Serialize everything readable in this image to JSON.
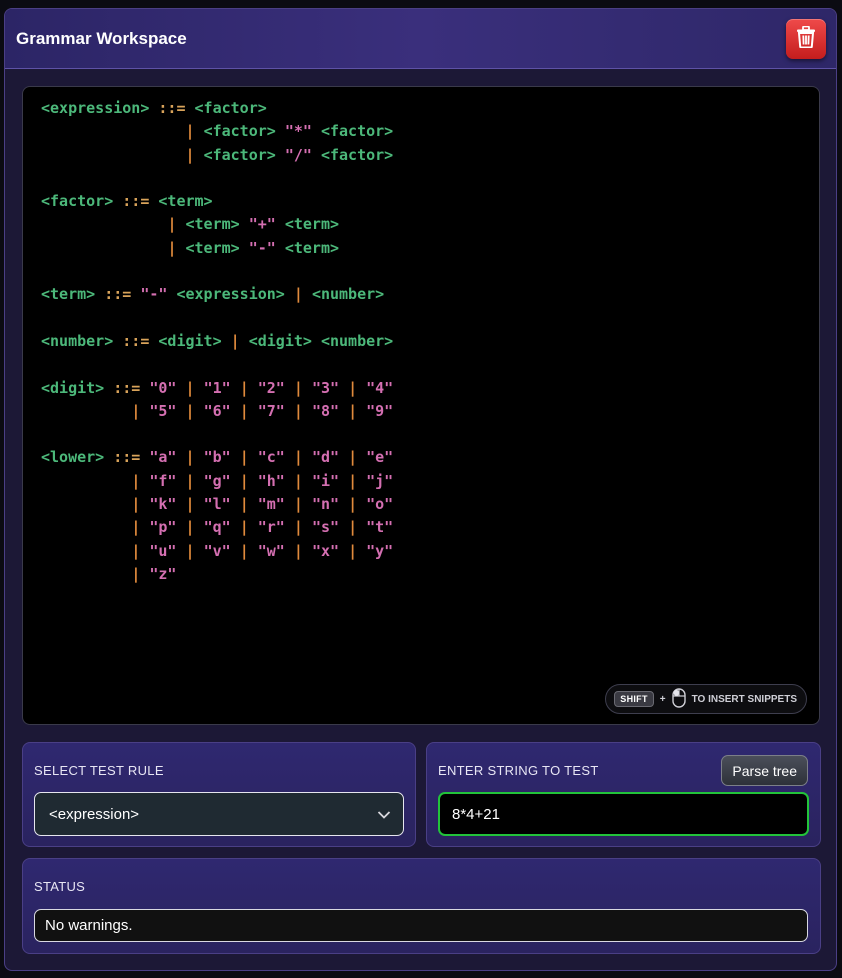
{
  "window": {
    "title": "Grammar Workspace"
  },
  "toolbar": {
    "delete_icon": "trash-icon",
    "delete_color": "#d92b2b"
  },
  "editor": {
    "lines": [
      [
        [
          "nt",
          "<expression>"
        ],
        [
          "sp",
          " "
        ],
        [
          "op",
          "::="
        ],
        [
          "sp",
          " "
        ],
        [
          "nt",
          "<factor>"
        ]
      ],
      [
        [
          "sp",
          "                "
        ],
        [
          "bar",
          "|"
        ],
        [
          "sp",
          " "
        ],
        [
          "nt",
          "<factor>"
        ],
        [
          "sp",
          " "
        ],
        [
          "lit",
          "\"*\""
        ],
        [
          "sp",
          " "
        ],
        [
          "nt",
          "<factor>"
        ]
      ],
      [
        [
          "sp",
          "                "
        ],
        [
          "bar",
          "|"
        ],
        [
          "sp",
          " "
        ],
        [
          "nt",
          "<factor>"
        ],
        [
          "sp",
          " "
        ],
        [
          "lit",
          "\"/\""
        ],
        [
          "sp",
          " "
        ],
        [
          "nt",
          "<factor>"
        ]
      ],
      [],
      [
        [
          "nt",
          "<factor>"
        ],
        [
          "sp",
          " "
        ],
        [
          "op",
          "::="
        ],
        [
          "sp",
          " "
        ],
        [
          "nt",
          "<term>"
        ]
      ],
      [
        [
          "sp",
          "              "
        ],
        [
          "bar",
          "|"
        ],
        [
          "sp",
          " "
        ],
        [
          "nt",
          "<term>"
        ],
        [
          "sp",
          " "
        ],
        [
          "lit",
          "\"+\""
        ],
        [
          "sp",
          " "
        ],
        [
          "nt",
          "<term>"
        ]
      ],
      [
        [
          "sp",
          "              "
        ],
        [
          "bar",
          "|"
        ],
        [
          "sp",
          " "
        ],
        [
          "nt",
          "<term>"
        ],
        [
          "sp",
          " "
        ],
        [
          "lit",
          "\"-\""
        ],
        [
          "sp",
          " "
        ],
        [
          "nt",
          "<term>"
        ]
      ],
      [],
      [
        [
          "nt",
          "<term>"
        ],
        [
          "sp",
          " "
        ],
        [
          "op",
          "::="
        ],
        [
          "sp",
          " "
        ],
        [
          "lit",
          "\"-\""
        ],
        [
          "sp",
          " "
        ],
        [
          "nt",
          "<expression>"
        ],
        [
          "sp",
          " "
        ],
        [
          "bar",
          "|"
        ],
        [
          "sp",
          " "
        ],
        [
          "nt",
          "<number>"
        ]
      ],
      [],
      [
        [
          "nt",
          "<number>"
        ],
        [
          "sp",
          " "
        ],
        [
          "op",
          "::="
        ],
        [
          "sp",
          " "
        ],
        [
          "nt",
          "<digit>"
        ],
        [
          "sp",
          " "
        ],
        [
          "bar",
          "|"
        ],
        [
          "sp",
          " "
        ],
        [
          "nt",
          "<digit>"
        ],
        [
          "sp",
          " "
        ],
        [
          "nt",
          "<number>"
        ]
      ],
      [],
      [
        [
          "nt",
          "<digit>"
        ],
        [
          "sp",
          " "
        ],
        [
          "op",
          "::="
        ],
        [
          "sp",
          " "
        ],
        [
          "lit",
          "\"0\""
        ],
        [
          "sp",
          " "
        ],
        [
          "bar",
          "|"
        ],
        [
          "sp",
          " "
        ],
        [
          "lit",
          "\"1\""
        ],
        [
          "sp",
          " "
        ],
        [
          "bar",
          "|"
        ],
        [
          "sp",
          " "
        ],
        [
          "lit",
          "\"2\""
        ],
        [
          "sp",
          " "
        ],
        [
          "bar",
          "|"
        ],
        [
          "sp",
          " "
        ],
        [
          "lit",
          "\"3\""
        ],
        [
          "sp",
          " "
        ],
        [
          "bar",
          "|"
        ],
        [
          "sp",
          " "
        ],
        [
          "lit",
          "\"4\""
        ]
      ],
      [
        [
          "sp",
          "          "
        ],
        [
          "bar",
          "|"
        ],
        [
          "sp",
          " "
        ],
        [
          "lit",
          "\"5\""
        ],
        [
          "sp",
          " "
        ],
        [
          "bar",
          "|"
        ],
        [
          "sp",
          " "
        ],
        [
          "lit",
          "\"6\""
        ],
        [
          "sp",
          " "
        ],
        [
          "bar",
          "|"
        ],
        [
          "sp",
          " "
        ],
        [
          "lit",
          "\"7\""
        ],
        [
          "sp",
          " "
        ],
        [
          "bar",
          "|"
        ],
        [
          "sp",
          " "
        ],
        [
          "lit",
          "\"8\""
        ],
        [
          "sp",
          " "
        ],
        [
          "bar",
          "|"
        ],
        [
          "sp",
          " "
        ],
        [
          "lit",
          "\"9\""
        ]
      ],
      [],
      [
        [
          "nt",
          "<lower>"
        ],
        [
          "sp",
          " "
        ],
        [
          "op",
          "::="
        ],
        [
          "sp",
          " "
        ],
        [
          "lit",
          "\"a\""
        ],
        [
          "sp",
          " "
        ],
        [
          "bar",
          "|"
        ],
        [
          "sp",
          " "
        ],
        [
          "lit",
          "\"b\""
        ],
        [
          "sp",
          " "
        ],
        [
          "bar",
          "|"
        ],
        [
          "sp",
          " "
        ],
        [
          "lit",
          "\"c\""
        ],
        [
          "sp",
          " "
        ],
        [
          "bar",
          "|"
        ],
        [
          "sp",
          " "
        ],
        [
          "lit",
          "\"d\""
        ],
        [
          "sp",
          " "
        ],
        [
          "bar",
          "|"
        ],
        [
          "sp",
          " "
        ],
        [
          "lit",
          "\"e\""
        ]
      ],
      [
        [
          "sp",
          "          "
        ],
        [
          "bar",
          "|"
        ],
        [
          "sp",
          " "
        ],
        [
          "lit",
          "\"f\""
        ],
        [
          "sp",
          " "
        ],
        [
          "bar",
          "|"
        ],
        [
          "sp",
          " "
        ],
        [
          "lit",
          "\"g\""
        ],
        [
          "sp",
          " "
        ],
        [
          "bar",
          "|"
        ],
        [
          "sp",
          " "
        ],
        [
          "lit",
          "\"h\""
        ],
        [
          "sp",
          " "
        ],
        [
          "bar",
          "|"
        ],
        [
          "sp",
          " "
        ],
        [
          "lit",
          "\"i\""
        ],
        [
          "sp",
          " "
        ],
        [
          "bar",
          "|"
        ],
        [
          "sp",
          " "
        ],
        [
          "lit",
          "\"j\""
        ]
      ],
      [
        [
          "sp",
          "          "
        ],
        [
          "bar",
          "|"
        ],
        [
          "sp",
          " "
        ],
        [
          "lit",
          "\"k\""
        ],
        [
          "sp",
          " "
        ],
        [
          "bar",
          "|"
        ],
        [
          "sp",
          " "
        ],
        [
          "lit",
          "\"l\""
        ],
        [
          "sp",
          " "
        ],
        [
          "bar",
          "|"
        ],
        [
          "sp",
          " "
        ],
        [
          "lit",
          "\"m\""
        ],
        [
          "sp",
          " "
        ],
        [
          "bar",
          "|"
        ],
        [
          "sp",
          " "
        ],
        [
          "lit",
          "\"n\""
        ],
        [
          "sp",
          " "
        ],
        [
          "bar",
          "|"
        ],
        [
          "sp",
          " "
        ],
        [
          "lit",
          "\"o\""
        ]
      ],
      [
        [
          "sp",
          "          "
        ],
        [
          "bar",
          "|"
        ],
        [
          "sp",
          " "
        ],
        [
          "lit",
          "\"p\""
        ],
        [
          "sp",
          " "
        ],
        [
          "bar",
          "|"
        ],
        [
          "sp",
          " "
        ],
        [
          "lit",
          "\"q\""
        ],
        [
          "sp",
          " "
        ],
        [
          "bar",
          "|"
        ],
        [
          "sp",
          " "
        ],
        [
          "lit",
          "\"r\""
        ],
        [
          "sp",
          " "
        ],
        [
          "bar",
          "|"
        ],
        [
          "sp",
          " "
        ],
        [
          "lit",
          "\"s\""
        ],
        [
          "sp",
          " "
        ],
        [
          "bar",
          "|"
        ],
        [
          "sp",
          " "
        ],
        [
          "lit",
          "\"t\""
        ]
      ],
      [
        [
          "sp",
          "          "
        ],
        [
          "bar",
          "|"
        ],
        [
          "sp",
          " "
        ],
        [
          "lit",
          "\"u\""
        ],
        [
          "sp",
          " "
        ],
        [
          "bar",
          "|"
        ],
        [
          "sp",
          " "
        ],
        [
          "lit",
          "\"v\""
        ],
        [
          "sp",
          " "
        ],
        [
          "bar",
          "|"
        ],
        [
          "sp",
          " "
        ],
        [
          "lit",
          "\"w\""
        ],
        [
          "sp",
          " "
        ],
        [
          "bar",
          "|"
        ],
        [
          "sp",
          " "
        ],
        [
          "lit",
          "\"x\""
        ],
        [
          "sp",
          " "
        ],
        [
          "bar",
          "|"
        ],
        [
          "sp",
          " "
        ],
        [
          "lit",
          "\"y\""
        ]
      ],
      [
        [
          "sp",
          "          "
        ],
        [
          "bar",
          "|"
        ],
        [
          "sp",
          " "
        ],
        [
          "lit",
          "\"z\""
        ]
      ]
    ],
    "hint": {
      "key": "SHIFT",
      "plus": "+",
      "mouse_icon": "mouse-icon",
      "text": "TO INSERT SNIPPETS"
    }
  },
  "test_rule": {
    "label": "SELECT TEST RULE",
    "selected": "<expression>",
    "icon": "chevron-down-icon"
  },
  "test_string": {
    "label": "ENTER STRING TO TEST",
    "value": "8*4+21",
    "parse_button": "Parse tree"
  },
  "status": {
    "label": "STATUS",
    "message": "No warnings."
  },
  "colors": {
    "nonterminal": "#4cb87a",
    "operator": "#d9a35a",
    "literal": "#d46fb1",
    "input_focus": "#22c33a"
  }
}
